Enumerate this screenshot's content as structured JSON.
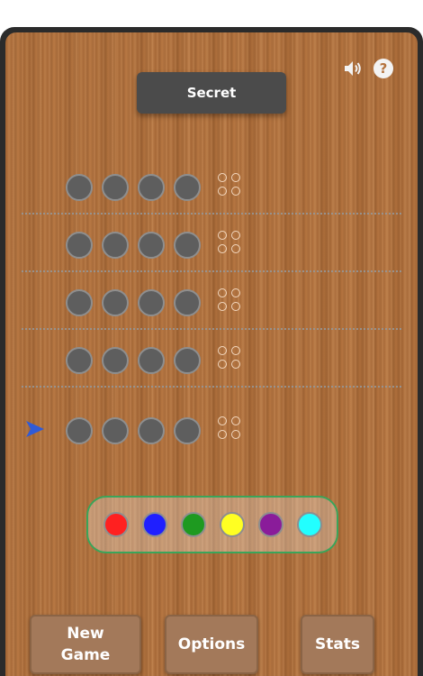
{
  "header": {
    "secret_label": "Secret",
    "sound_icon": "speaker-icon",
    "help_icon": "help-icon"
  },
  "guess_rows": [
    {
      "pegs": [
        "empty",
        "empty",
        "empty",
        "empty"
      ],
      "feedback": [
        "empty",
        "empty",
        "empty",
        "empty"
      ],
      "active": false
    },
    {
      "pegs": [
        "empty",
        "empty",
        "empty",
        "empty"
      ],
      "feedback": [
        "empty",
        "empty",
        "empty",
        "empty"
      ],
      "active": false
    },
    {
      "pegs": [
        "empty",
        "empty",
        "empty",
        "empty"
      ],
      "feedback": [
        "empty",
        "empty",
        "empty",
        "empty"
      ],
      "active": false
    },
    {
      "pegs": [
        "empty",
        "empty",
        "empty",
        "empty"
      ],
      "feedback": [
        "empty",
        "empty",
        "empty",
        "empty"
      ],
      "active": false
    },
    {
      "pegs": [
        "empty",
        "empty",
        "empty",
        "empty"
      ],
      "feedback": [
        "empty",
        "empty",
        "empty",
        "empty"
      ],
      "active": true
    }
  ],
  "active_row_indicator": "arrow-right-icon",
  "palette": {
    "colors": [
      {
        "name": "red",
        "hex": "#ff2020"
      },
      {
        "name": "blue",
        "hex": "#1f1fff"
      },
      {
        "name": "green",
        "hex": "#1e9a20"
      },
      {
        "name": "yellow",
        "hex": "#ffff22"
      },
      {
        "name": "purple",
        "hex": "#8a1c9a"
      },
      {
        "name": "cyan",
        "hex": "#22ffff"
      }
    ],
    "border_color": "#3aa55a"
  },
  "buttons": {
    "new_game_line1": "New",
    "new_game_line2": "Game",
    "options": "Options",
    "stats": "Stats"
  },
  "colors": {
    "frame": "#2b2b2b",
    "wood": "#b5743f",
    "secret_bg": "#4b4b4b",
    "empty_peg": "#5e5e5e",
    "arrow": "#2f5bd8",
    "button_bg": "#a3795a"
  }
}
